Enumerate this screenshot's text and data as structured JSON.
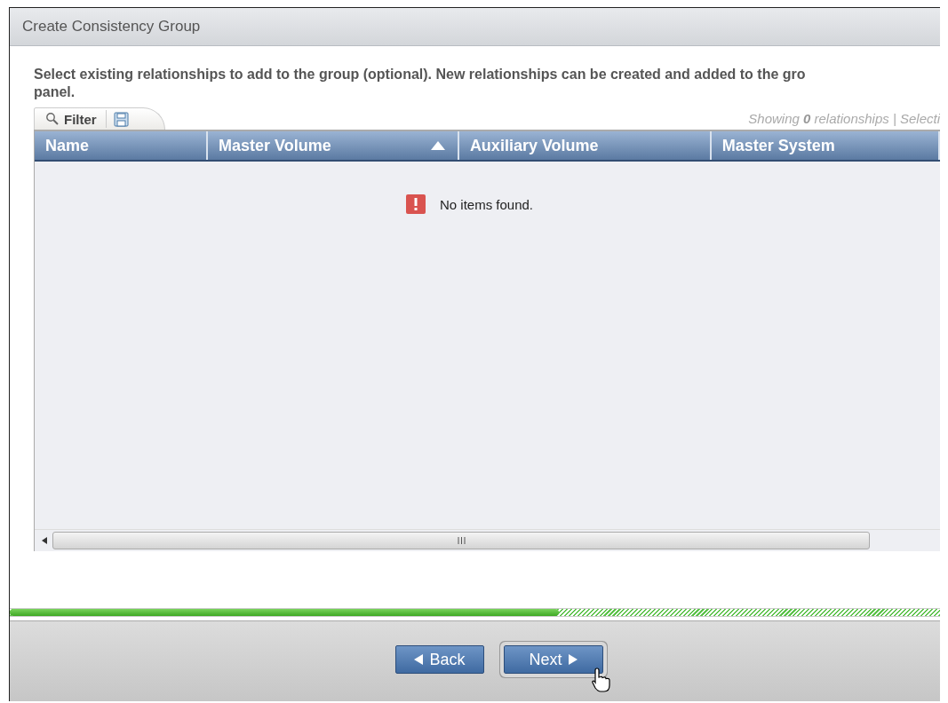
{
  "window": {
    "title": "Create Consistency Group"
  },
  "instructions": [
    "Select existing relationships to add to the group (optional). New relationships can be created and added to the gro",
    "panel."
  ],
  "toolbar": {
    "filter_label": "Filter",
    "status": "Showing **0** relationships | Selecti"
  },
  "table": {
    "columns": [
      {
        "label": "Name",
        "sorted": false
      },
      {
        "label": "Master Volume",
        "sorted": true
      },
      {
        "label": "Auxiliary Volume",
        "sorted": false
      },
      {
        "label": "Master System",
        "sorted": false
      }
    ],
    "empty_message": "No items found."
  },
  "progress": {
    "level": 0.59
  },
  "buttons": [
    {
      "label": "Back",
      "kind": "back",
      "focused": false
    },
    {
      "label": "Next",
      "kind": "next",
      "focused": true
    }
  ]
}
